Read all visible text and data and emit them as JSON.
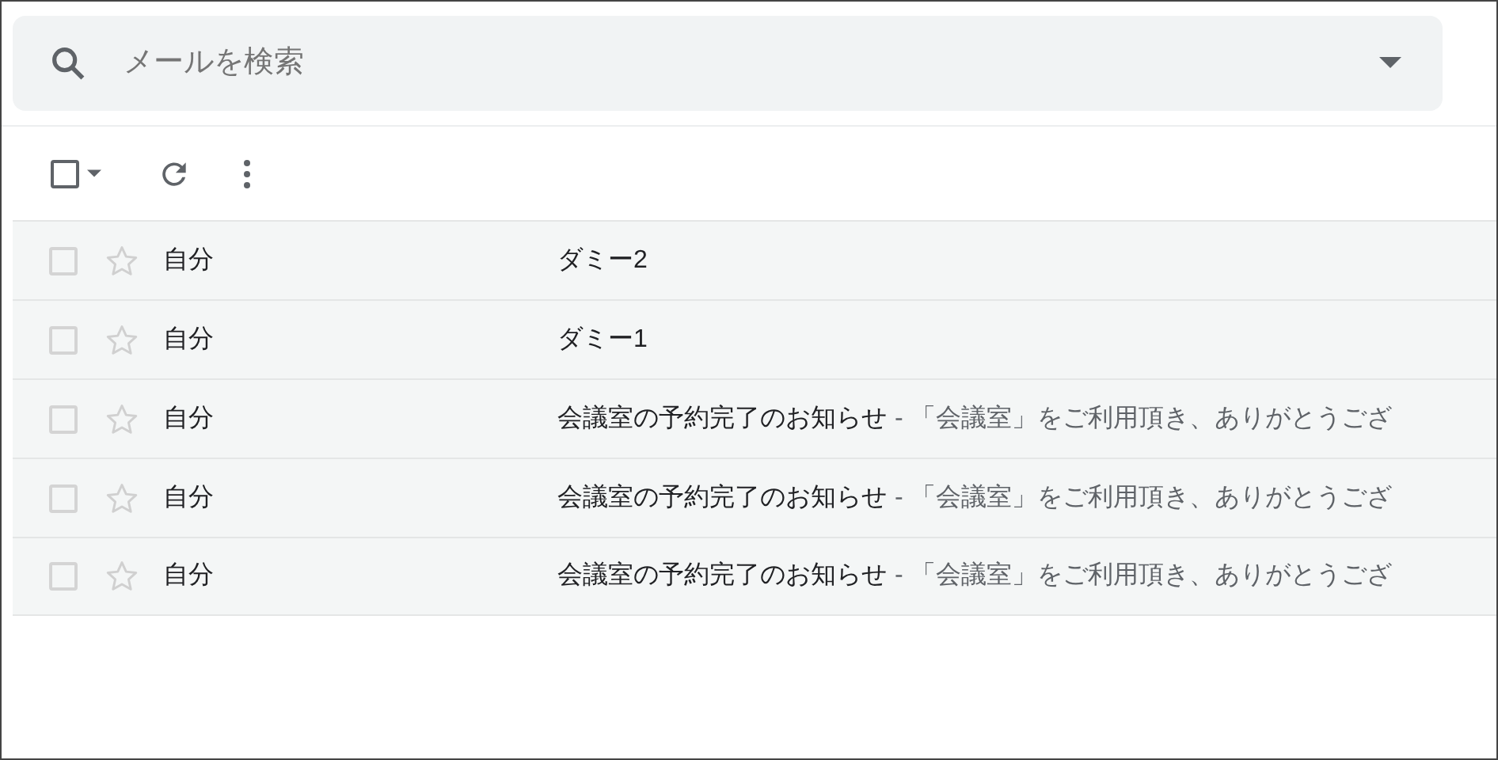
{
  "search": {
    "placeholder": "メールを検索"
  },
  "toolbar": {
    "select_all": {
      "checked": false
    }
  },
  "messages": [
    {
      "checked": false,
      "starred": false,
      "sender": "自分",
      "subject": "ダミー2"
    },
    {
      "checked": false,
      "starred": false,
      "sender": "自分",
      "subject": "ダミー1"
    },
    {
      "checked": false,
      "starred": false,
      "sender": "自分",
      "subject": "会議室の予約完了のお知らせ",
      "snippet": "- 「会議室」をご利用頂き、ありがとうござ"
    },
    {
      "checked": false,
      "starred": false,
      "sender": "自分",
      "subject": "会議室の予約完了のお知らせ",
      "snippet": "- 「会議室」をご利用頂き、ありがとうござ"
    },
    {
      "checked": false,
      "starred": false,
      "sender": "自分",
      "subject": "会議室の予約完了のお知らせ",
      "snippet": "- 「会議室」をご利用頂き、ありがとうござ"
    }
  ]
}
